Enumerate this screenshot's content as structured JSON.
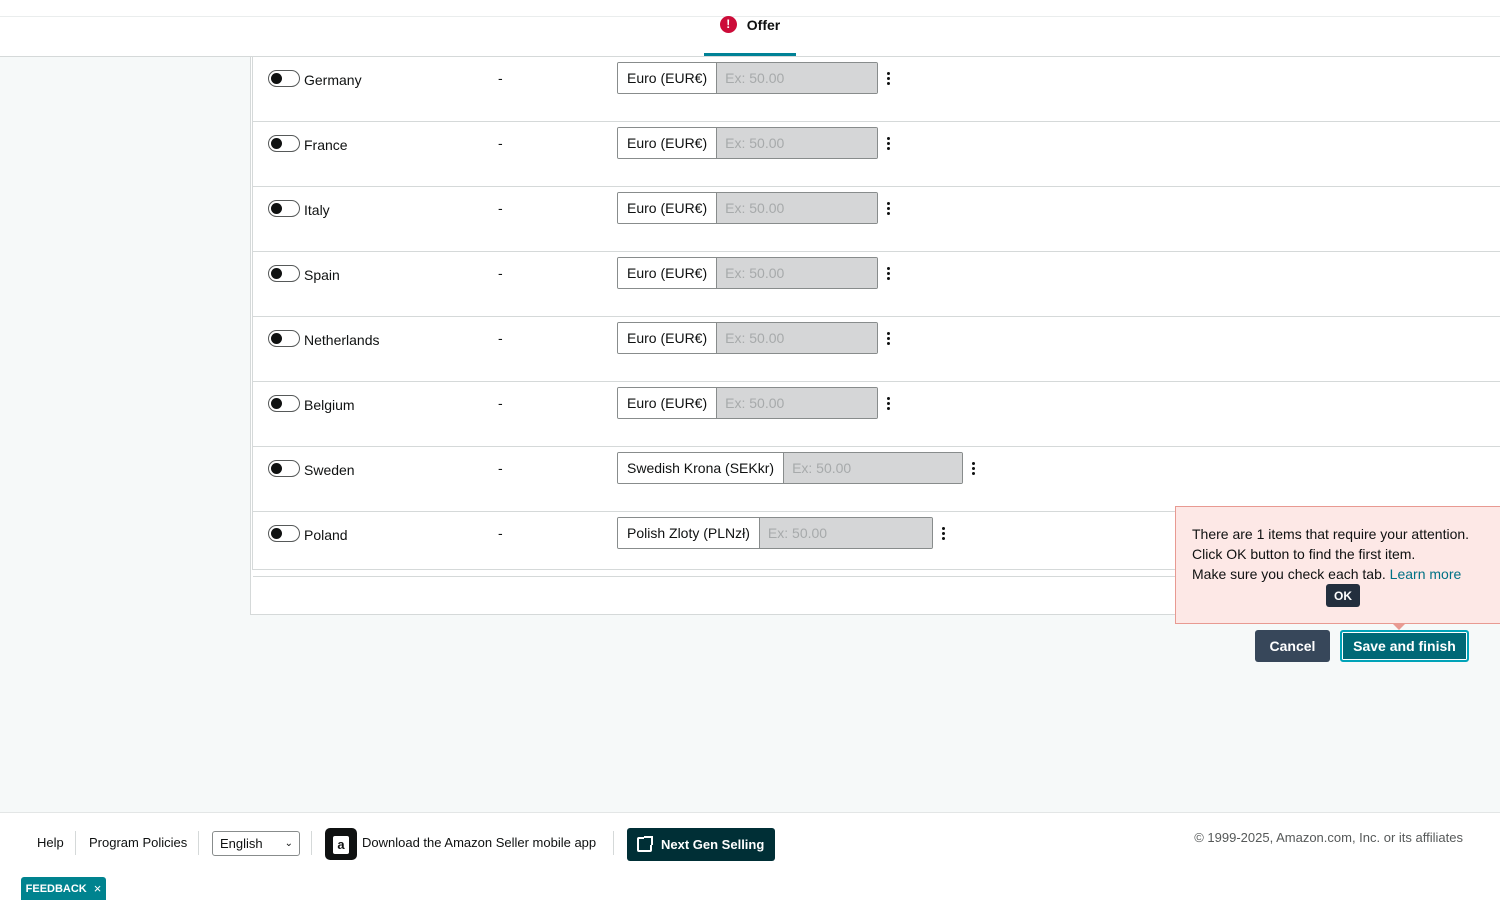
{
  "tabs": {
    "offer_label": "Offer",
    "offer_alert_glyph": "!"
  },
  "rows": [
    {
      "country": "Germany",
      "status": "-",
      "currency": "Euro (EUR€)",
      "placeholder": "Ex: 50.00"
    },
    {
      "country": "France",
      "status": "-",
      "currency": "Euro (EUR€)",
      "placeholder": "Ex: 50.00"
    },
    {
      "country": "Italy",
      "status": "-",
      "currency": "Euro (EUR€)",
      "placeholder": "Ex: 50.00"
    },
    {
      "country": "Spain",
      "status": "-",
      "currency": "Euro (EUR€)",
      "placeholder": "Ex: 50.00"
    },
    {
      "country": "Netherlands",
      "status": "-",
      "currency": "Euro (EUR€)",
      "placeholder": "Ex: 50.00"
    },
    {
      "country": "Belgium",
      "status": "-",
      "currency": "Euro (EUR€)",
      "placeholder": "Ex: 50.00"
    },
    {
      "country": "Sweden",
      "status": "-",
      "currency": "Swedish Krona (SEKkr)",
      "placeholder": "Ex: 50.00"
    },
    {
      "country": "Poland",
      "status": "-",
      "currency": "Polish Zloty (PLNzł)",
      "placeholder": "Ex: 50.00"
    }
  ],
  "attention": {
    "line1": "There are 1 items that require your attention.",
    "line2": "Click OK button to find the first item.",
    "line3": "Make sure you check each tab.",
    "learn_more": "Learn more",
    "ok_label": "OK"
  },
  "actions": {
    "cancel_label": "Cancel",
    "save_label": "Save and finish"
  },
  "footer": {
    "help": "Help",
    "program_policies": "Program Policies",
    "language": "English",
    "download_app": "Download the Amazon Seller mobile app",
    "next_gen": "Next Gen Selling",
    "copyright": "© 1999-2025, Amazon.com, Inc. or its affiliates",
    "app_icon_glyph": "a"
  },
  "feedback": {
    "label": "FEEDBACK",
    "close_glyph": "×"
  },
  "colors": {
    "accent": "#008296",
    "alert": "#cc0c39",
    "save_button": "#006876",
    "popover_bg": "#fde8e6"
  },
  "icons": [
    "alert-icon",
    "kebab-menu-icon",
    "external-link-icon",
    "amazon-app-icon",
    "chevron-down-icon",
    "close-icon"
  ]
}
